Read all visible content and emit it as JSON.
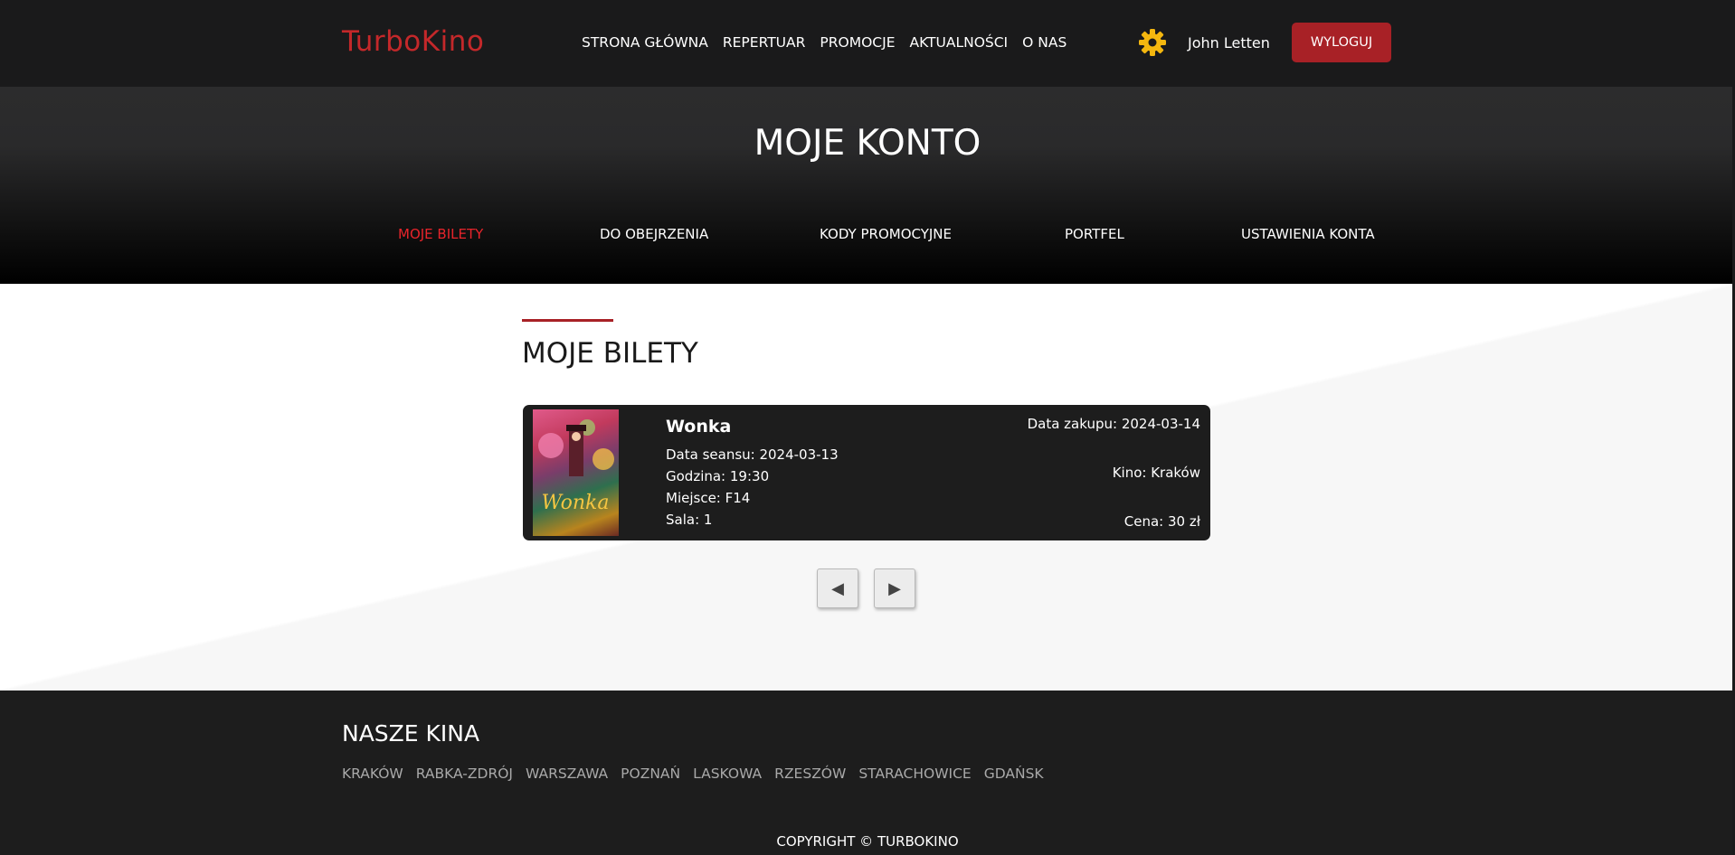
{
  "header": {
    "logo": "TurboKino",
    "nav": [
      "STRONA GŁÓWNA",
      "REPERTUAR",
      "PROMOCJE",
      "AKTUALNOŚCI",
      "O NAS"
    ],
    "user_name": "John Letten",
    "logout_label": "WYLOGUJ",
    "accent_color": "#a82126"
  },
  "hero": {
    "title": "MOJE KONTO",
    "tabs": [
      {
        "label": "MOJE BILETY",
        "active": true
      },
      {
        "label": "DO OBEJRZENIA",
        "active": false
      },
      {
        "label": "KODY PROMOCYJNE",
        "active": false
      },
      {
        "label": "PORTFEL",
        "active": false
      },
      {
        "label": "USTAWIENIA KONTA",
        "active": false
      }
    ]
  },
  "main": {
    "section_title": "MOJE BILETY",
    "ticket": {
      "movie": "Wonka",
      "session_date": "Data seansu: 2024-03-13",
      "time": "Godzina: 19:30",
      "seat": "Miejsce: F14",
      "hall": "Sala: 1",
      "purchase_date": "Data zakupu: 2024-03-14",
      "cinema": "Kino: Kraków",
      "price": "Cena: 30 zł",
      "poster_text": "Wonka"
    },
    "pager": {
      "prev": "◀",
      "next": "▶"
    }
  },
  "footer": {
    "title": "NASZE KINA",
    "cinemas": [
      "KRAKÓW",
      "RABKA-ZDRÓJ",
      "WARSZAWA",
      "POZNAŃ",
      "LASKOWA",
      "RZESZÓW",
      "STARACHOWICE",
      "GDAŃSK"
    ],
    "copyright": "COPYRIGHT © TURBOKINO"
  }
}
